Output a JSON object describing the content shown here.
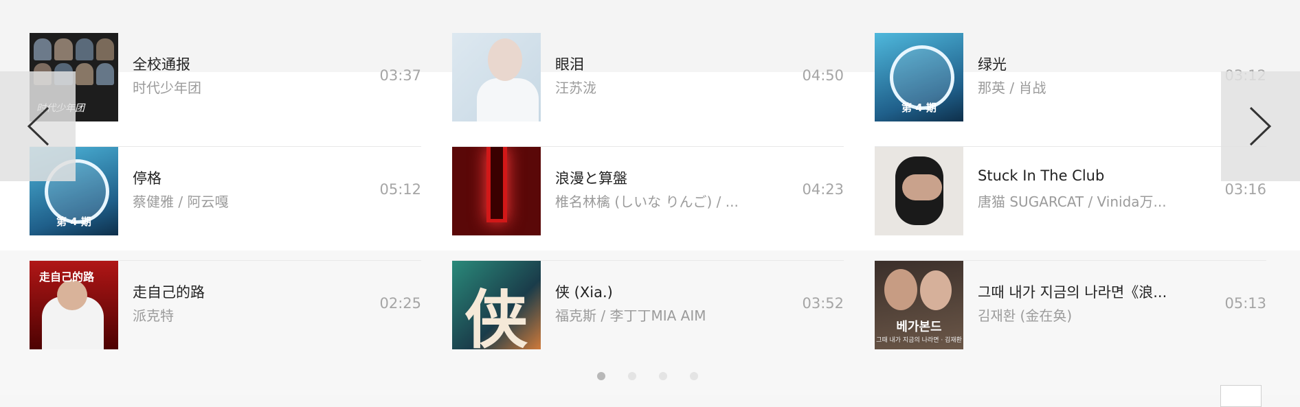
{
  "songs": [
    {
      "title": "全校通报",
      "artist": "时代少年团",
      "duration": "03:37"
    },
    {
      "title": "眼泪",
      "artist": "汪苏泷",
      "duration": "04:50"
    },
    {
      "title": "绿光",
      "artist": "那英 / 肖战",
      "duration": "03:12"
    },
    {
      "title": "停格",
      "artist": "蔡健雅 / 阿云嘎",
      "duration": "05:12"
    },
    {
      "title": "浪漫と算盤",
      "artist": "椎名林檎 (しいな りんご) / ...",
      "duration": "04:23"
    },
    {
      "title": "Stuck In The Club",
      "artist": "唐猫 SUGARCAT / Vinida万...",
      "duration": "03:16"
    },
    {
      "title": "走自己的路",
      "artist": "派克特",
      "duration": "02:25"
    },
    {
      "title": "侠 (Xia.)",
      "artist": "福克斯 / 李丁丁MIA AIM",
      "duration": "03:52"
    },
    {
      "title": "그때 내가 지금의 나라면《浪...",
      "artist": "김재환 (金在奂)",
      "duration": "05:13"
    }
  ],
  "covers": {
    "c1_wordmark": "时代少年团",
    "c3_episode": "第 4 期",
    "c4_episode": "第 4 期",
    "c7_text": "走自己的路",
    "c8_glyph": "侠",
    "c9_title": "베가본드",
    "c9_subtitle": "그때 내가 지금의 나라면 · 김재환"
  },
  "pager": {
    "total": 4,
    "active_index": 0
  },
  "icons": {
    "prev": "chevron-left-icon",
    "next": "chevron-right-icon"
  },
  "colors": {
    "title": "#222222",
    "artist": "#9b9b9b",
    "duration": "#a5a5a5",
    "dot_active": "#b8b8b8",
    "dot": "#e4e4e4"
  }
}
